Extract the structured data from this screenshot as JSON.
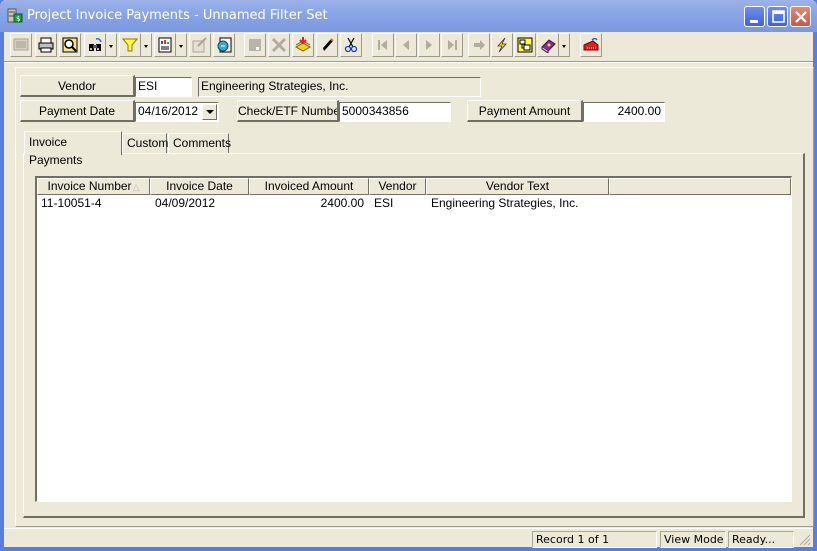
{
  "window": {
    "title": "Project Invoice Payments - Unnamed Filter Set",
    "icon": "project-invoice-icon",
    "controls": [
      "minimize",
      "maximize",
      "close"
    ]
  },
  "toolbar": {
    "buttons": [
      {
        "name": "new-record",
        "icon": "new-record-icon",
        "enabled": false
      },
      {
        "name": "print",
        "icon": "printer-icon",
        "enabled": true
      },
      {
        "name": "print-preview",
        "icon": "print-preview-icon",
        "enabled": true
      },
      {
        "name": "find",
        "icon": "binoculars-icon",
        "enabled": true,
        "dropdown": true
      },
      {
        "name": "filter",
        "icon": "funnel-icon",
        "enabled": true,
        "dropdown": true
      },
      {
        "name": "report",
        "icon": "report-icon",
        "enabled": true,
        "dropdown": true
      },
      {
        "name": "edit-properties",
        "icon": "properties-icon",
        "enabled": false
      },
      {
        "name": "export",
        "icon": "export-icon",
        "enabled": true
      },
      {
        "name": "save",
        "icon": "save-icon",
        "enabled": false
      },
      {
        "name": "delete",
        "icon": "delete-icon",
        "enabled": false
      },
      {
        "name": "import",
        "icon": "import-stack-icon",
        "enabled": true
      },
      {
        "name": "edit",
        "icon": "pencil-icon",
        "enabled": true
      },
      {
        "name": "cut",
        "icon": "scissors-icon",
        "enabled": true
      },
      {
        "name": "first-record",
        "icon": "first-record-icon",
        "enabled": false
      },
      {
        "name": "previous-record",
        "icon": "previous-record-icon",
        "enabled": false
      },
      {
        "name": "next-record",
        "icon": "next-record-icon",
        "enabled": false
      },
      {
        "name": "last-record",
        "icon": "last-record-icon",
        "enabled": false
      },
      {
        "name": "go-to",
        "icon": "arrow-right-icon",
        "enabled": false
      },
      {
        "name": "quick-action",
        "icon": "lightning-icon",
        "enabled": true
      },
      {
        "name": "workflow",
        "icon": "workflow-icon",
        "enabled": true
      },
      {
        "name": "help",
        "icon": "help-book-icon",
        "enabled": true,
        "dropdown": true
      },
      {
        "name": "exit",
        "icon": "exit-icon",
        "enabled": true
      }
    ]
  },
  "form": {
    "vendor_label": "Vendor",
    "vendor_code": "ESI",
    "vendor_name": "Engineering Strategies, Inc.",
    "payment_date_label": "Payment Date",
    "payment_date": "04/16/2012",
    "check_label": "Check/ETF Number",
    "check_number": "5000343856",
    "payment_amount_label": "Payment Amount",
    "payment_amount": "2400.00"
  },
  "tabs": [
    {
      "label": "Invoice Payments",
      "active": true
    },
    {
      "label": "Custom",
      "active": false
    },
    {
      "label": "Comments",
      "active": false
    }
  ],
  "grid": {
    "columns": [
      {
        "label": "Invoice Number",
        "sorted": "ascending"
      },
      {
        "label": "Invoice Date"
      },
      {
        "label": "Invoiced Amount"
      },
      {
        "label": "Vendor"
      },
      {
        "label": "Vendor Text"
      },
      {
        "label": ""
      }
    ],
    "rows": [
      [
        "11-10051-4",
        "04/09/2012",
        "2400.00",
        "ESI",
        "Engineering Strategies, Inc.",
        ""
      ]
    ]
  },
  "status": {
    "record": "Record 1 of 1",
    "mode": "View Mode",
    "state": "Ready..."
  }
}
